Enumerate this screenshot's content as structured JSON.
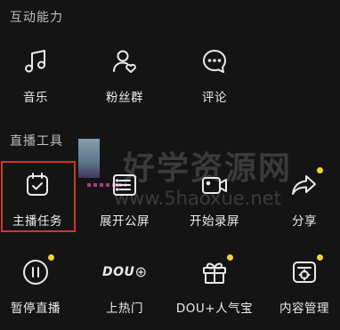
{
  "sections": {
    "interactive": {
      "title": "互动能力"
    },
    "tools": {
      "title": "直播工具"
    }
  },
  "interactive_items": [
    {
      "label": "音乐",
      "icon": "music-note-icon"
    },
    {
      "label": "粉丝群",
      "icon": "fan-group-icon"
    },
    {
      "label": "评论",
      "icon": "comment-icon"
    }
  ],
  "tool_items": [
    {
      "label": "主播任务",
      "icon": "task-calendar-icon",
      "highlighted": true,
      "dot": false
    },
    {
      "label": "展开公屏",
      "icon": "expand-screen-icon",
      "dot": false
    },
    {
      "label": "开始录屏",
      "icon": "video-camera-icon",
      "dot": false
    },
    {
      "label": "分享",
      "icon": "share-arrow-icon",
      "dot": true
    },
    {
      "label": "暂停直播",
      "icon": "pause-icon",
      "dot": true
    },
    {
      "label": "上热门",
      "icon": "dou-plus-icon",
      "icon_text": "DOU",
      "dot": false
    },
    {
      "label": "DOU+人气宝",
      "icon": "gift-box-icon",
      "dot": true
    },
    {
      "label": "内容管理",
      "icon": "content-manage-icon",
      "dot": true
    }
  ],
  "watermark": {
    "main": "好学资源网",
    "url": "www.5haoxue.net"
  },
  "colors": {
    "background": "#141414",
    "highlight_border": "#d2332e",
    "badge_dot": "#f4d23c"
  }
}
